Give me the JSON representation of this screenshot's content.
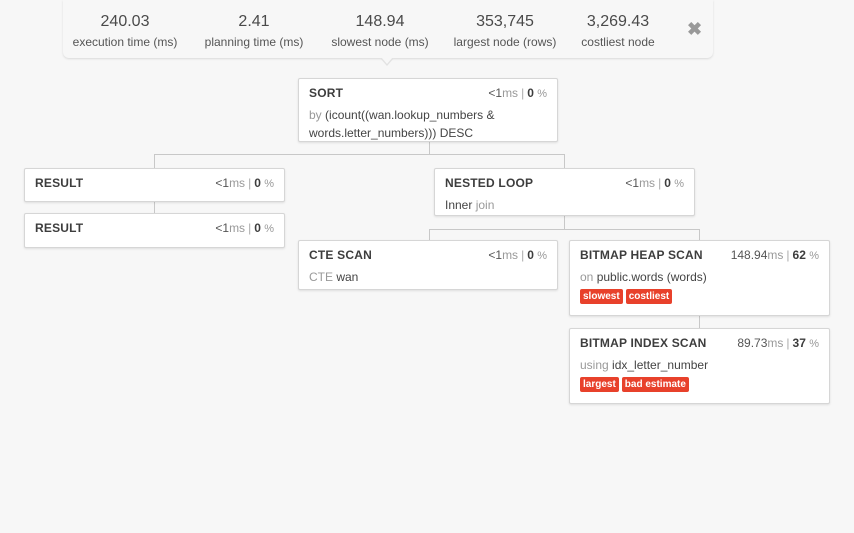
{
  "stats": [
    {
      "value": "240.03",
      "label": "execution time (ms)"
    },
    {
      "value": "2.41",
      "label": "planning time (ms)"
    },
    {
      "value": "148.94",
      "label": "slowest node (ms)"
    },
    {
      "value": "353,745",
      "label": "largest node (rows)"
    },
    {
      "value": "3,269.43",
      "label": "costliest node"
    }
  ],
  "close_glyph": "✖",
  "pipe": "|",
  "pct_sign": "%",
  "nodes": {
    "sort": {
      "title": "SORT",
      "time": "<1",
      "unit": "ms",
      "pct": "0",
      "desc_prefix": "by",
      "desc": "(icount((wan.lookup_numbers & words.letter_numbers))) DESC"
    },
    "result1": {
      "title": "RESULT",
      "time": "<1",
      "unit": "ms",
      "pct": "0"
    },
    "result2": {
      "title": "RESULT",
      "time": "<1",
      "unit": "ms",
      "pct": "0"
    },
    "nested_loop": {
      "title": "NESTED LOOP",
      "time": "<1",
      "unit": "ms",
      "pct": "0",
      "desc": "Inner",
      "desc_suffix": "join"
    },
    "cte_scan": {
      "title": "CTE SCAN",
      "time": "<1",
      "unit": "ms",
      "pct": "0",
      "desc_prefix": "CTE",
      "desc": "wan"
    },
    "bitmap_heap": {
      "title": "BITMAP HEAP SCAN",
      "time": "148.94",
      "unit": "ms",
      "pct": "62",
      "desc_prefix": "on",
      "desc": "public.words (words)",
      "tags": [
        "slowest",
        "costliest"
      ]
    },
    "bitmap_index": {
      "title": "BITMAP INDEX SCAN",
      "time": "89.73",
      "unit": "ms",
      "pct": "37",
      "desc_prefix": "using",
      "desc": "idx_letter_number",
      "tags": [
        "largest",
        "bad estimate"
      ]
    }
  },
  "colors": {
    "tag": "#e8412b",
    "connector": "#c8c8c8"
  }
}
